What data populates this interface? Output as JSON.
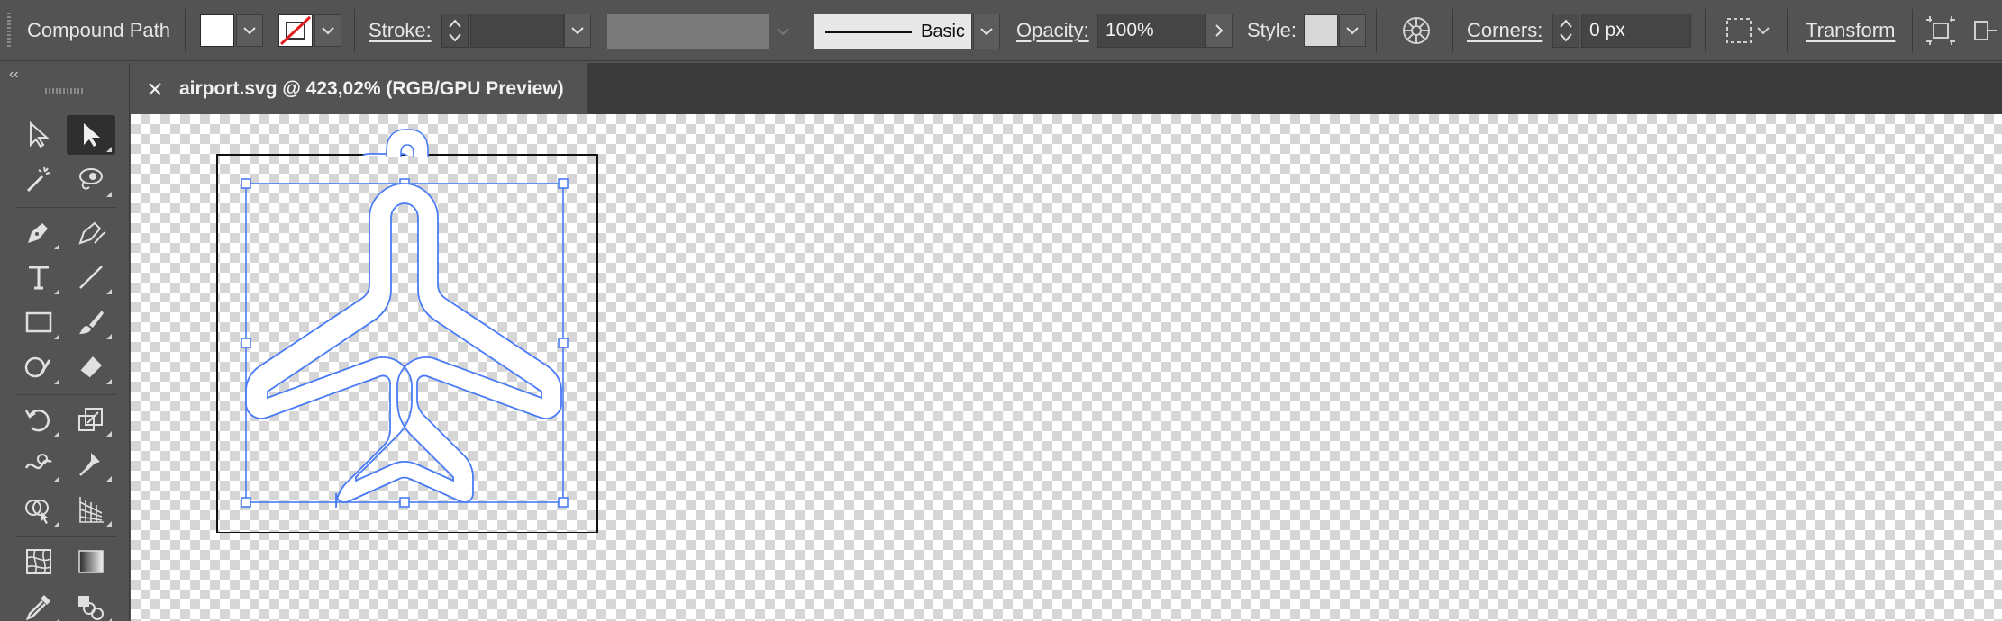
{
  "control_bar": {
    "object_type": "Compound Path",
    "stroke_label": "Stroke:",
    "stroke_weight": "",
    "brush_name": "Basic",
    "opacity_label": "Opacity:",
    "opacity_value": "100%",
    "style_label": "Style:",
    "corners_label": "Corners:",
    "corners_value": "0 px",
    "transform_label": "Transform",
    "fill_color": "#ffffff",
    "stroke_color": "none"
  },
  "toolbar": {
    "tools": [
      "direct-selection",
      "selection",
      "magic-wand",
      "lasso",
      "pen",
      "curvature",
      "type",
      "line-segment",
      "rectangle",
      "paintbrush",
      "shaper",
      "eraser",
      "rotate",
      "scale",
      "warp",
      "puppet-warp",
      "shape-builder",
      "perspective-grid",
      "mesh",
      "gradient",
      "eyedropper",
      "blend"
    ],
    "active_tool": "selection"
  },
  "document": {
    "tab_title": "airport.svg @ 423,02% (RGB/GPU Preview)"
  },
  "colors": {
    "ui_bg": "#535353",
    "selection_blue": "#4a7bf7",
    "artboard_border": "#111111"
  }
}
